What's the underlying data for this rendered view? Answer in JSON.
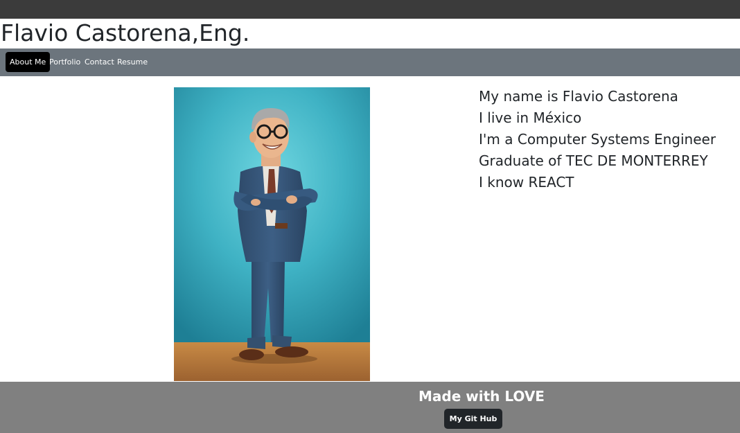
{
  "header": {
    "title": "Flavio Castorena,Eng."
  },
  "nav": {
    "items": [
      {
        "label": "About Me",
        "active": true
      },
      {
        "label": "Portfolio",
        "active": false
      },
      {
        "label": "Contact",
        "active": false
      },
      {
        "label": "Resume",
        "active": false
      }
    ]
  },
  "about": {
    "photo_icon": "cartoon-portrait",
    "bio_lines": [
      "My name is Flavio Castorena",
      "I live in México",
      "I'm a Computer Systems Engineer",
      "Graduate of TEC DE MONTERREY",
      "I know REACT"
    ]
  },
  "footer": {
    "title": "Made with LOVE",
    "github_label": "My Git Hub"
  },
  "colors": {
    "topbar": "#3b3b3b",
    "navbar": "#6c757d",
    "footer": "#808080",
    "button": "#212529"
  }
}
